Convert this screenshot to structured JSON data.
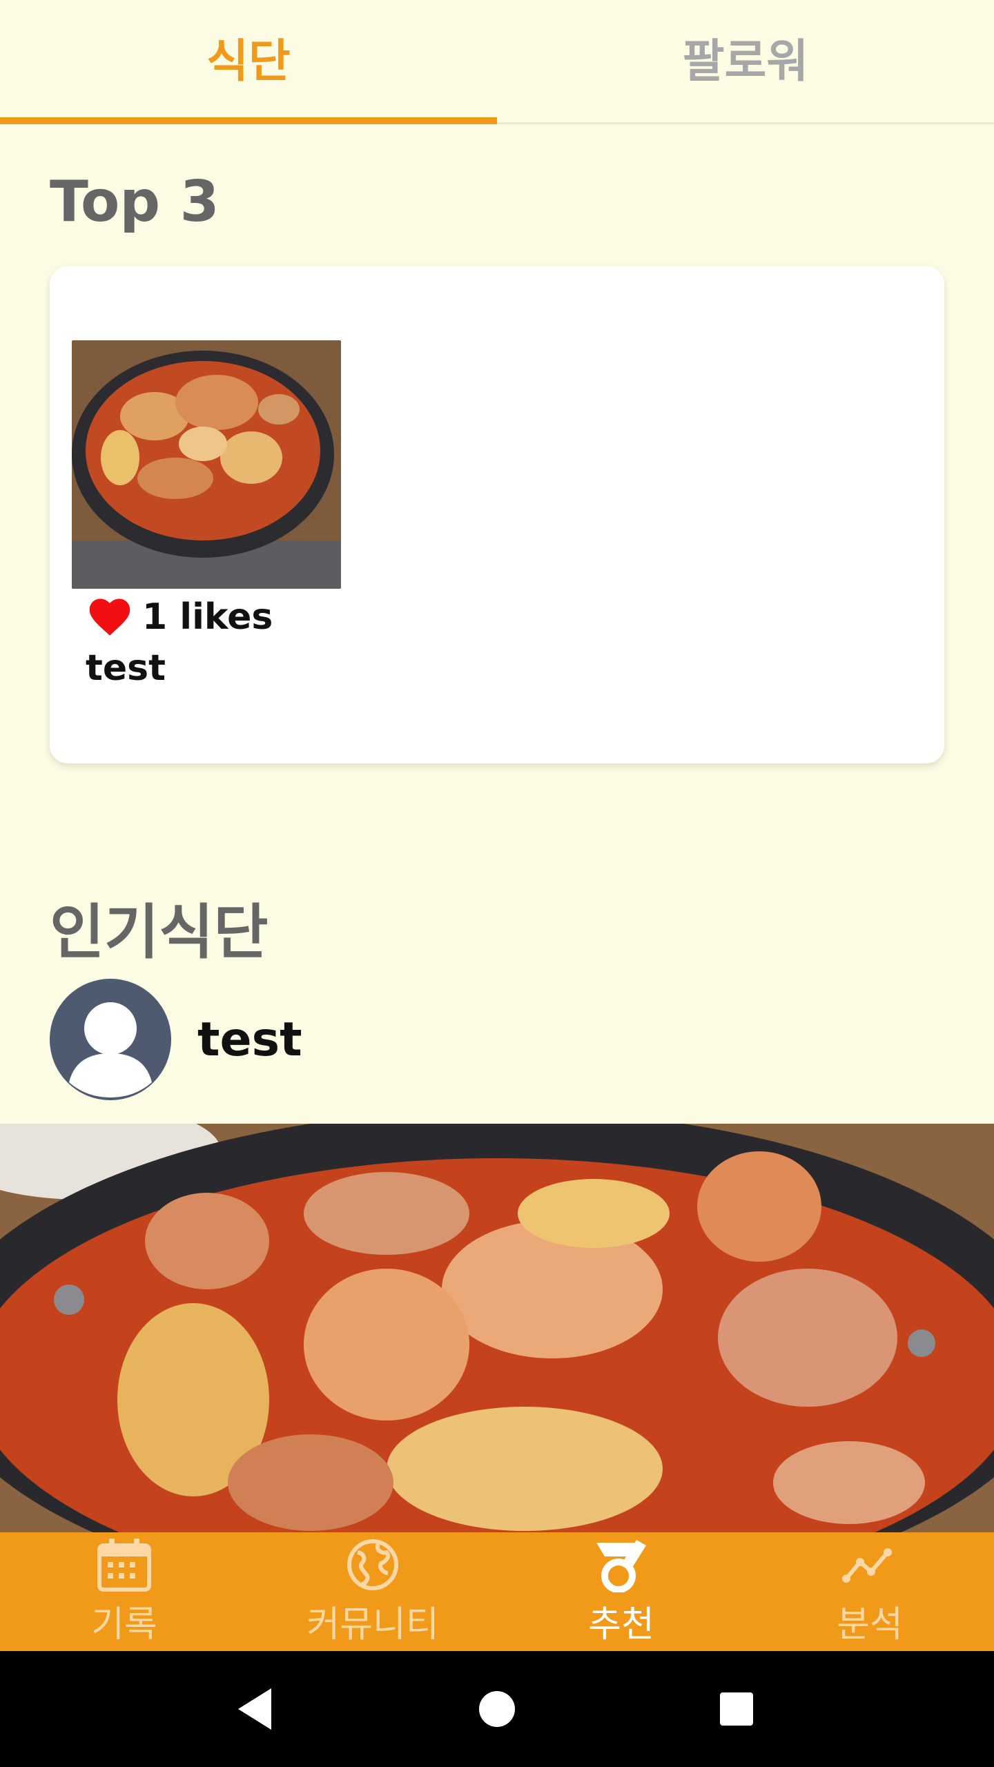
{
  "tabs": [
    {
      "label": "식단",
      "active": true
    },
    {
      "label": "팔로워",
      "active": false
    }
  ],
  "top3": {
    "title": "Top 3",
    "items": [
      {
        "likes_text": "1 likes",
        "author": "test",
        "likes": 1
      }
    ]
  },
  "popular": {
    "title": "인기식단",
    "user_name": "test"
  },
  "bottom_nav": [
    {
      "label": "기록",
      "icon": "calendar-icon",
      "active": false
    },
    {
      "label": "커뮤니티",
      "icon": "globe-icon",
      "active": false
    },
    {
      "label": "추천",
      "icon": "recommend-icon",
      "active": true
    },
    {
      "label": "분석",
      "icon": "chart-line-icon",
      "active": false
    }
  ],
  "colors": {
    "accent": "#f19a1a",
    "background": "#fcfbe3",
    "heart": "#f20f12",
    "avatar": "#4e5a70"
  }
}
